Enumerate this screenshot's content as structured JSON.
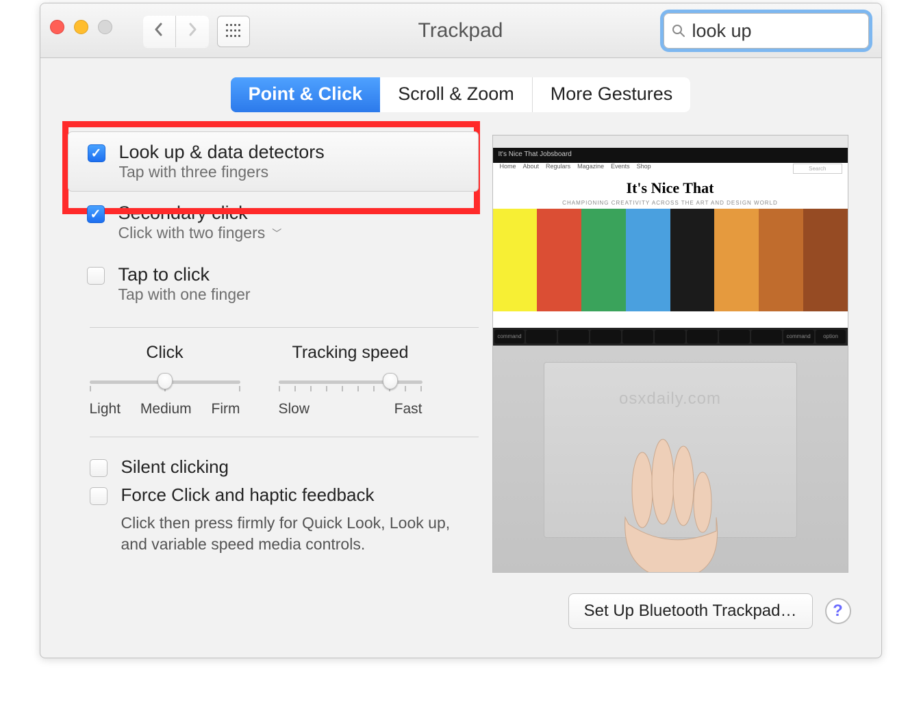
{
  "window": {
    "title": "Trackpad"
  },
  "search": {
    "value": "look up",
    "placeholder": "Search"
  },
  "tabs": {
    "items": [
      "Point & Click",
      "Scroll & Zoom",
      "More Gestures"
    ],
    "active_index": 0
  },
  "options": {
    "lookup": {
      "title": "Look up & data detectors",
      "subtitle": "Tap with three fingers",
      "checked": true
    },
    "secondary": {
      "title": "Secondary click",
      "subtitle": "Click with two fingers",
      "has_menu": true,
      "checked": true
    },
    "tapclick": {
      "title": "Tap to click",
      "subtitle": "Tap with one finger",
      "checked": false
    }
  },
  "sliders": {
    "click": {
      "label": "Click",
      "ticks": 3,
      "index": 1,
      "low": "Light",
      "mid": "Medium",
      "high": "Firm"
    },
    "tracking": {
      "label": "Tracking speed",
      "ticks": 10,
      "index": 7,
      "low": "Slow",
      "high": "Fast"
    }
  },
  "advanced": {
    "silent": {
      "label": "Silent clicking",
      "checked": false
    },
    "force": {
      "label": "Force Click and haptic feedback",
      "checked": false,
      "desc": "Click then press firmly for Quick Look, Look up, and variable speed media controls."
    }
  },
  "preview": {
    "brand": "It's Nice That",
    "tagline": "CHAMPIONING CREATIVITY ACROSS THE ART AND DESIGN WORLD",
    "watermark": "osxdaily.com",
    "blackbar": "It's Nice That   Jobsboard",
    "menu": [
      "Home",
      "About",
      "Regulars",
      "Magazine",
      "Events",
      "Shop"
    ],
    "search_label": "Search",
    "keys": [
      "command",
      "",
      "",
      "",
      "",
      "",
      "",
      "",
      "",
      "command",
      "option"
    ],
    "art_colors": [
      "#f7ef34",
      "#db4e34",
      "#3aa35b",
      "#4aa0df",
      "#1b1b1b",
      "#e59a3e",
      "#c06c2d",
      "#964b23"
    ]
  },
  "footer": {
    "bluetooth": "Set Up Bluetooth Trackpad…"
  }
}
